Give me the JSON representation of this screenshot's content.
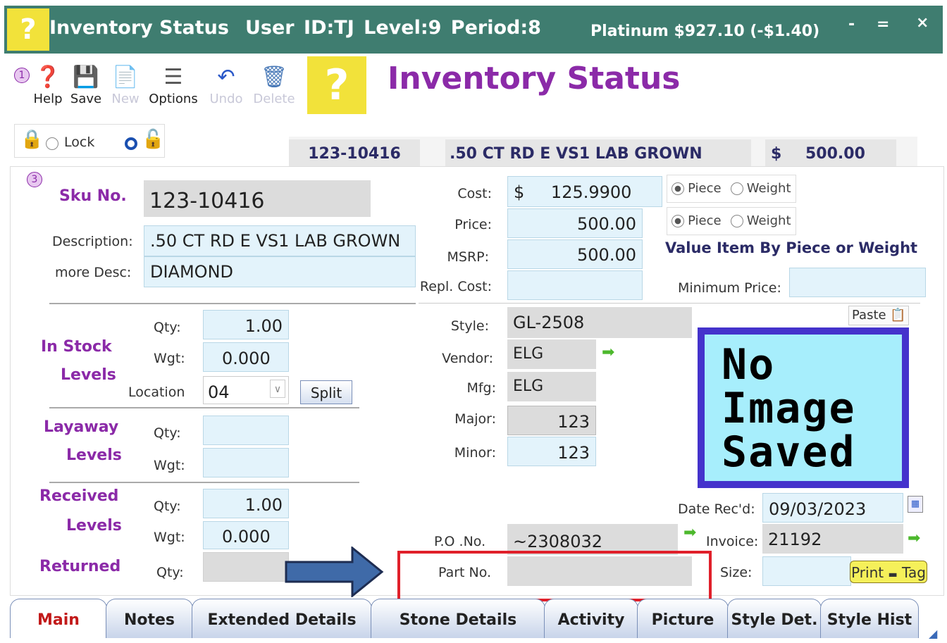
{
  "titlebar": {
    "app_title": "Inventory Status",
    "user_info": "User ID:TJ  Level:9  Period:8",
    "metal_price": "Platinum $927.10 (-$1.40)",
    "minimize": "-",
    "maximize": "=",
    "close": "×"
  },
  "toolbar": {
    "step_badge": "1",
    "help": "Help",
    "save": "Save",
    "new": "New",
    "options": "Options",
    "undo": "Undo",
    "delete": "Delete"
  },
  "page_title": "Inventory Status",
  "lock": {
    "label": "Lock"
  },
  "summary": {
    "sku": "123-10416",
    "description": ".50 CT RD E VS1 LAB GROWN",
    "currency": "$",
    "price": "500.00"
  },
  "form": {
    "step_badge": "3",
    "sku_label": "Sku No.",
    "sku_value": "123-10416",
    "description_label": "Description:",
    "description_value": ".50 CT RD E VS1 LAB GROWN",
    "more_desc_label": "more Desc:",
    "more_desc_value": "DIAMOND",
    "cost_label": "Cost:",
    "cost_currency": "$",
    "cost_value": "125.9900",
    "price_label": "Price:",
    "price_value": "500.00",
    "msrp_label": "MSRP:",
    "msrp_value": "500.00",
    "repl_cost_label": "Repl. Cost:",
    "repl_cost_value": "",
    "piece_label": "Piece",
    "weight_label": "Weight",
    "value_by_label": "Value Item By Piece or Weight",
    "min_price_label": "Minimum Price:",
    "min_price_value": ""
  },
  "in_stock": {
    "title1": "In Stock",
    "title2": "Levels",
    "qty_label": "Qty:",
    "qty": "1.00",
    "wgt_label": "Wgt:",
    "wgt": "0.000",
    "location_label": "Location",
    "location": "04",
    "split": "Split"
  },
  "layaway": {
    "title1": "Layaway",
    "title2": "Levels",
    "qty_label": "Qty:",
    "wgt_label": "Wgt:",
    "qty": "",
    "wgt": ""
  },
  "received": {
    "title1": "Received",
    "title2": "Levels",
    "qty_label": "Qty:",
    "qty": "1.00",
    "wgt_label": "Wgt:",
    "wgt": "0.000"
  },
  "returned": {
    "title": "Returned",
    "qty_label": "Qty:",
    "qty": ""
  },
  "style_info": {
    "style_label": "Style:",
    "style": "GL-2508",
    "vendor_label": "Vendor:",
    "vendor": "ELG",
    "mfg_label": "Mfg:",
    "mfg": "ELG",
    "major_label": "Major:",
    "major": "123",
    "minor_label": "Minor:",
    "minor": "123"
  },
  "image": {
    "paste": "Paste",
    "line1": "No",
    "line2": "Image",
    "line3": "Saved"
  },
  "bottom": {
    "date_recd_label": "Date Rec'd:",
    "date_recd": "09/03/2023",
    "po_label": "P.O .No.",
    "po": "~2308032",
    "invoice_label": "Invoice:",
    "invoice": "21192",
    "part_label": "Part No.",
    "part": "",
    "size_label": "Size:",
    "size": "",
    "print_tag": "Print",
    "tag": "Tag"
  },
  "tabs": [
    "Main",
    "Notes",
    "Extended Details",
    "Stone Details",
    "Activity",
    "Picture",
    "Style Det.",
    "Style Hist"
  ],
  "colors": {
    "titlebar": "#3f7d70",
    "accent_purple": "#8b2aa8",
    "field_blue": "#e3f3fb",
    "highlight_red": "#e0202a",
    "arrow_blue": "#3f6aa8"
  }
}
